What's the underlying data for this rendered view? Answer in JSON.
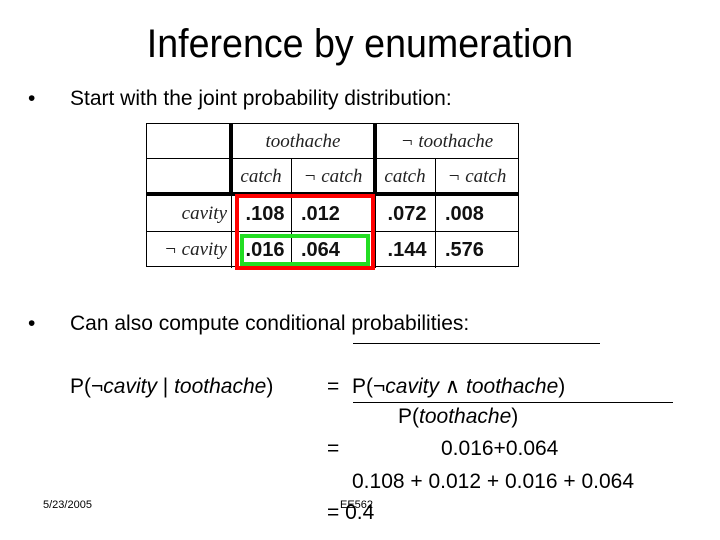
{
  "slide": {
    "title": "Inference by enumeration",
    "bullets": [
      {
        "icon": "bullet-dot",
        "text": "Start with the joint probability distribution:"
      },
      {
        "icon": "bullet-dot",
        "text": "Can also compute conditional probabilities:"
      }
    ],
    "bullet_glyph": "•"
  },
  "joint_table": {
    "column_groups": [
      "toothache",
      "¬ toothache"
    ],
    "sub_columns": [
      "catch",
      "¬ catch",
      "catch",
      "¬ catch"
    ],
    "rows": [
      {
        "label": "cavity",
        "values": [
          ".108",
          ".012",
          ".072",
          ".008"
        ]
      },
      {
        "label": "¬ cavity",
        "values": [
          ".016",
          ".064",
          ".144",
          ".576"
        ]
      }
    ],
    "highlights": {
      "red_box": "toothache columns, both rows",
      "green_box": "toothache columns, ¬cavity row",
      "red_color": "#ff0000",
      "green_color": "#22dd22"
    }
  },
  "equation": {
    "lhs_prefix": "P(",
    "lhs_neg": "¬",
    "lhs_var1": "cavity",
    "lhs_bar": " | ",
    "lhs_var2": "toothache",
    "lhs_suffix": ")",
    "eq1": "=",
    "num_prefix": "P(",
    "num_neg": "¬",
    "num_var1": "cavity",
    "num_and": " ∧ ",
    "num_var2": "toothache",
    "num_suffix": ")",
    "den_prefix": "P(",
    "den_var": "toothache",
    "den_suffix": ")",
    "eq2": "=",
    "numeric_numerator": "0.016+0.064",
    "numeric_denominator": "0.108 + 0.012 + 0.016 + 0.064",
    "eq3": "= 0.4"
  },
  "footer": {
    "date": "5/23/2005",
    "course": "EE562"
  }
}
